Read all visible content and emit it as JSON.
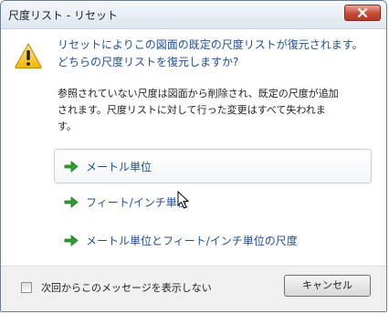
{
  "window": {
    "title": "尺度リスト - リセット"
  },
  "message": {
    "main_line1": "リセットによりこの図面の既定の尺度リストが復元されます。",
    "main_line2": "どちらの尺度リストを復元しますか?",
    "desc_line1": "参照されていない尺度は図面から削除され、既定の尺度が追加",
    "desc_line2": "されます。尺度リストに対して行った変更はすべて失われま",
    "desc_line3": "す。"
  },
  "options": [
    {
      "label": "メートル単位"
    },
    {
      "label": "フィート/インチ単位"
    },
    {
      "label": "メートル単位とフィート/インチ単位の尺度"
    }
  ],
  "footer": {
    "checkbox_label": "次回からこのメッセージを表示しない",
    "checkbox_checked": false,
    "cancel_label": "キャンセル"
  },
  "icons": {
    "warning": "warning-icon",
    "close": "close-icon",
    "option_arrow": "green-arrow-icon"
  },
  "colors": {
    "instruction": "#1e4f99",
    "arrow": "#2e9e2e",
    "close_button": "#c74a36"
  }
}
